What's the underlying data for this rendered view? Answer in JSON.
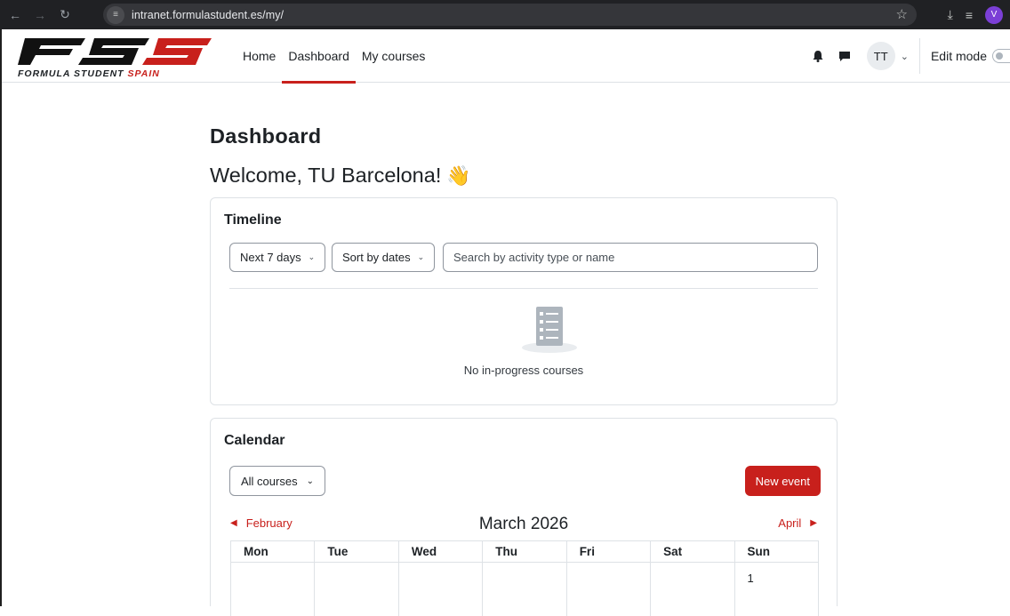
{
  "browser": {
    "url": "intranet.formulastudent.es/my/",
    "profile_initial": "V"
  },
  "site": {
    "logo_caption_main": "FORMULA STUDENT",
    "logo_caption_accent": "SPAIN",
    "nav_items": [
      "Home",
      "Dashboard",
      "My courses"
    ],
    "active_nav": "Dashboard",
    "avatar_initials": "TT",
    "edit_mode_label": "Edit mode"
  },
  "page": {
    "title": "Dashboard",
    "welcome": "Welcome, TU Barcelona!",
    "welcome_emoji": "👋"
  },
  "timeline": {
    "title": "Timeline",
    "filter_label": "Next 7 days",
    "sort_label": "Sort by dates",
    "search_placeholder": "Search by activity type or name",
    "empty_message": "No in-progress courses"
  },
  "calendar": {
    "title": "Calendar",
    "course_filter": "All courses",
    "new_event_label": "New event",
    "prev_month": "February",
    "current_month": "March 2026",
    "next_month": "April",
    "weekdays": [
      "Mon",
      "Tue",
      "Wed",
      "Thu",
      "Fri",
      "Sat",
      "Sun"
    ],
    "first_week": [
      "",
      "",
      "",
      "",
      "",
      "",
      "1"
    ]
  },
  "colors": {
    "brand_red": "#c8201c",
    "chrome_bg": "#202124"
  }
}
